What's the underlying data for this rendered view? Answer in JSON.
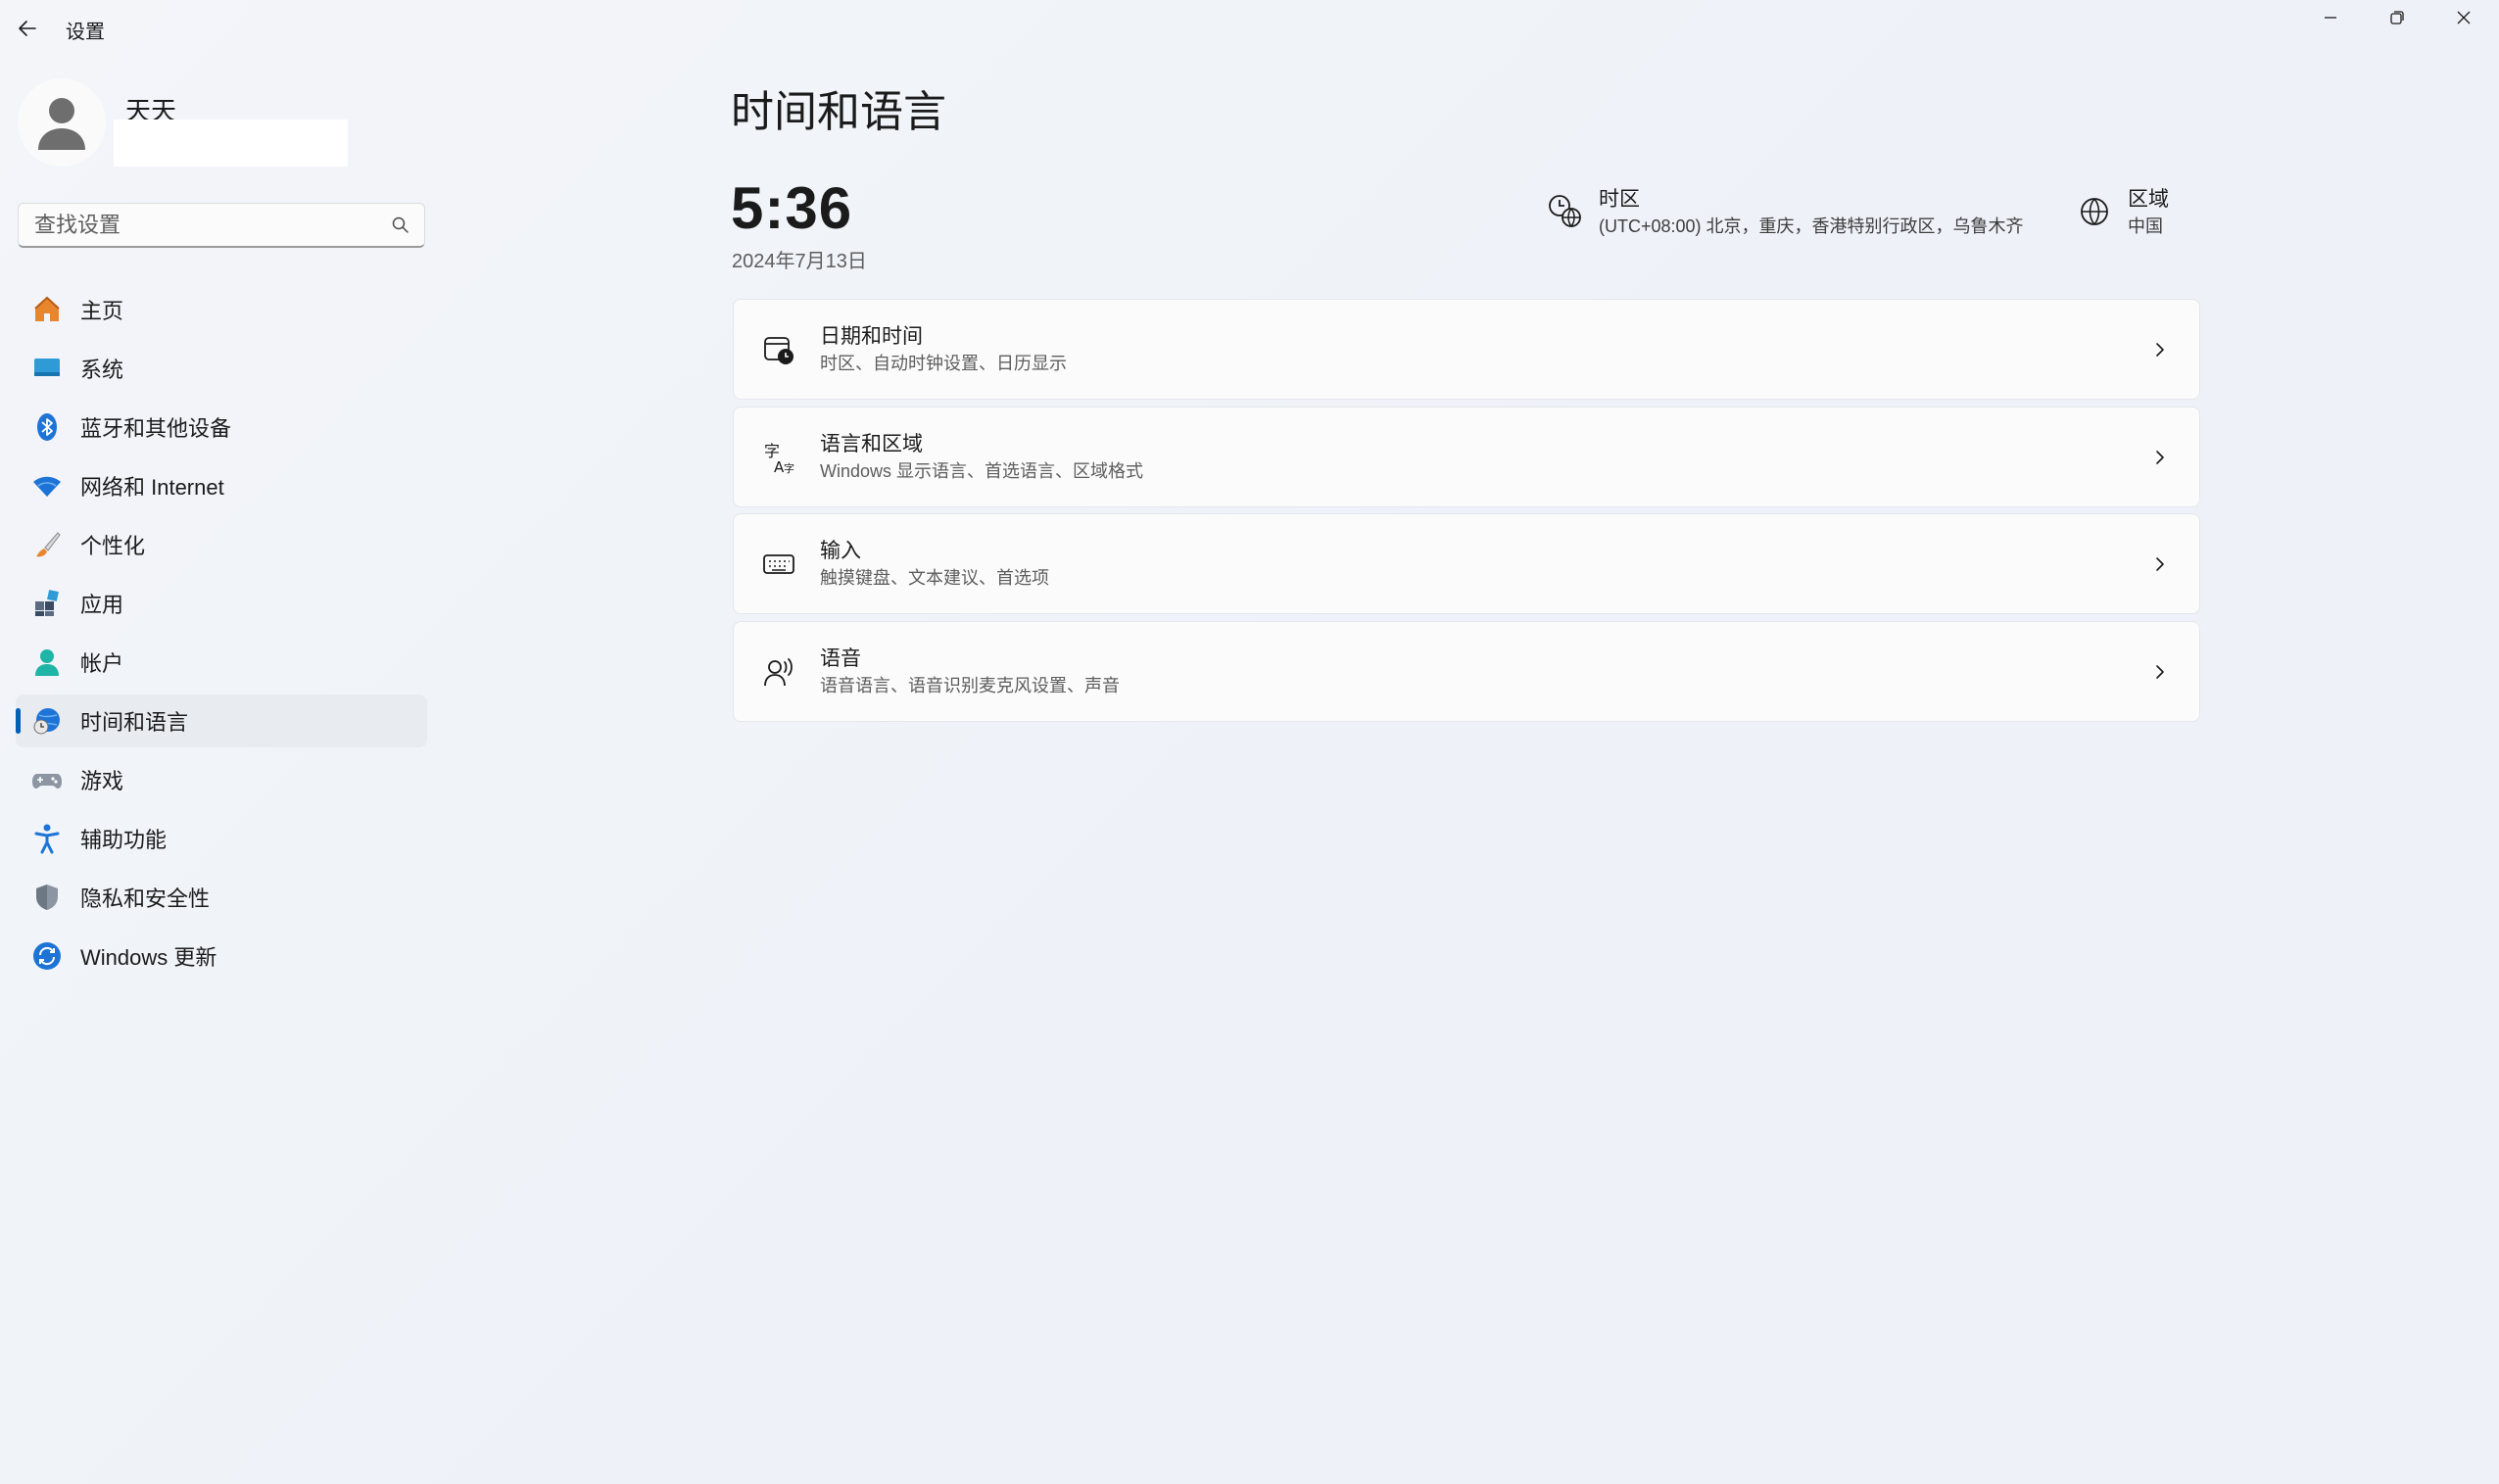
{
  "window": {
    "title": "设置",
    "controls": [
      "minimize",
      "restore",
      "close"
    ]
  },
  "user": {
    "name": "天天"
  },
  "search": {
    "placeholder": "查找设置"
  },
  "sidebar": {
    "items": [
      {
        "label": "主页",
        "icon": "home-icon"
      },
      {
        "label": "系统",
        "icon": "system-icon"
      },
      {
        "label": "蓝牙和其他设备",
        "icon": "bluetooth-icon"
      },
      {
        "label": "网络和 Internet",
        "icon": "wifi-icon"
      },
      {
        "label": "个性化",
        "icon": "brush-icon"
      },
      {
        "label": "应用",
        "icon": "apps-icon"
      },
      {
        "label": "帐户",
        "icon": "account-icon"
      },
      {
        "label": "时间和语言",
        "icon": "time-language-icon",
        "selected": true
      },
      {
        "label": "游戏",
        "icon": "gamepad-icon"
      },
      {
        "label": "辅助功能",
        "icon": "accessibility-icon"
      },
      {
        "label": "隐私和安全性",
        "icon": "shield-icon"
      },
      {
        "label": "Windows 更新",
        "icon": "update-icon"
      }
    ]
  },
  "main": {
    "title": "时间和语言",
    "time": "5:36",
    "date": "2024年7月13日",
    "timezone": {
      "title": "时区",
      "value": "(UTC+08:00) 北京，重庆，香港特别行政区，乌鲁木齐"
    },
    "region": {
      "title": "区域",
      "value": "中国"
    },
    "cards": [
      {
        "title": "日期和时间",
        "subtitle": "时区、自动时钟设置、日历显示",
        "icon": "calendar-clock-icon"
      },
      {
        "title": "语言和区域",
        "subtitle": "Windows 显示语言、首选语言、区域格式",
        "icon": "language-icon"
      },
      {
        "title": "输入",
        "subtitle": "触摸键盘、文本建议、首选项",
        "icon": "keyboard-icon"
      },
      {
        "title": "语音",
        "subtitle": "语音语言、语音识别麦克风设置、声音",
        "icon": "speech-icon"
      }
    ]
  },
  "colors": {
    "accent": "#005fb8",
    "selected_nav_bg": "#e8ebf0"
  }
}
